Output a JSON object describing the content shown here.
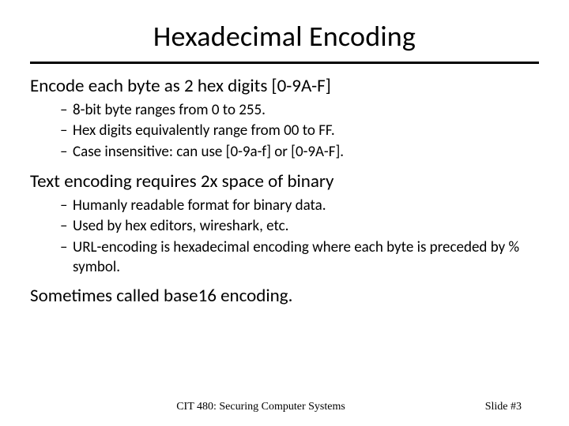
{
  "title": "Hexadecimal Encoding",
  "sections": [
    {
      "heading": "Encode each byte as 2 hex digits [0-9A-F]",
      "bullets": [
        "8-bit byte ranges from 0 to 255.",
        "Hex digits equivalently range from 00 to FF.",
        "Case insensitive: can use [0-9a-f] or [0-9A-F]."
      ]
    },
    {
      "heading": "Text encoding requires 2x space of binary",
      "bullets": [
        "Humanly readable format for binary data.",
        "Used by hex editors, wireshark, etc.",
        "URL-encoding is hexadecimal encoding where each byte is preceded by % symbol."
      ]
    },
    {
      "heading": "Sometimes called base16 encoding.",
      "bullets": []
    }
  ],
  "footer": {
    "course": "CIT 480: Securing Computer Systems",
    "slide": "Slide #3"
  }
}
